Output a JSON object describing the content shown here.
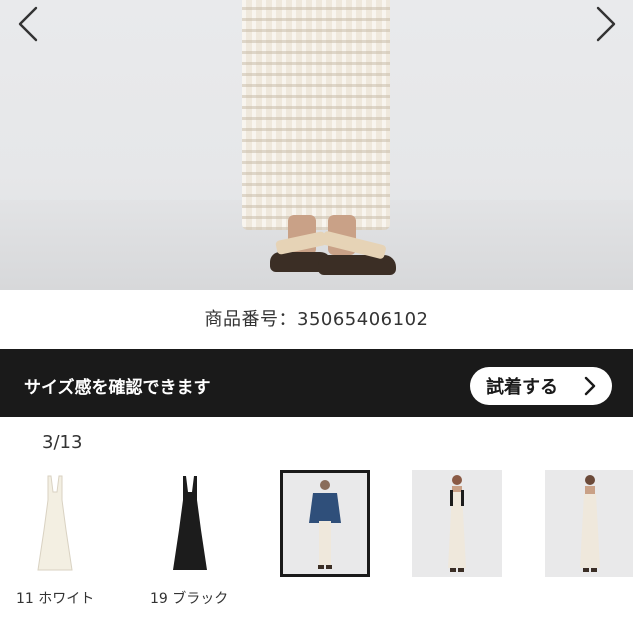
{
  "hero": {
    "prev_icon": "chevron-left-icon",
    "next_icon": "chevron-right-icon"
  },
  "product_number": "商品番号：35065406102",
  "fit_banner": {
    "text": "サイズ感を確認できます",
    "button_label": "試着する",
    "button_icon": "chevron-right-icon"
  },
  "gallery": {
    "counter": "3/13",
    "thumbnails": [
      {
        "label": "11 ホワイト",
        "color": "#f3efe2"
      },
      {
        "label": "19 ブラック",
        "color": "#1c1c1c"
      },
      {
        "label": "",
        "selected": true
      },
      {
        "label": ""
      },
      {
        "label": ""
      }
    ]
  }
}
